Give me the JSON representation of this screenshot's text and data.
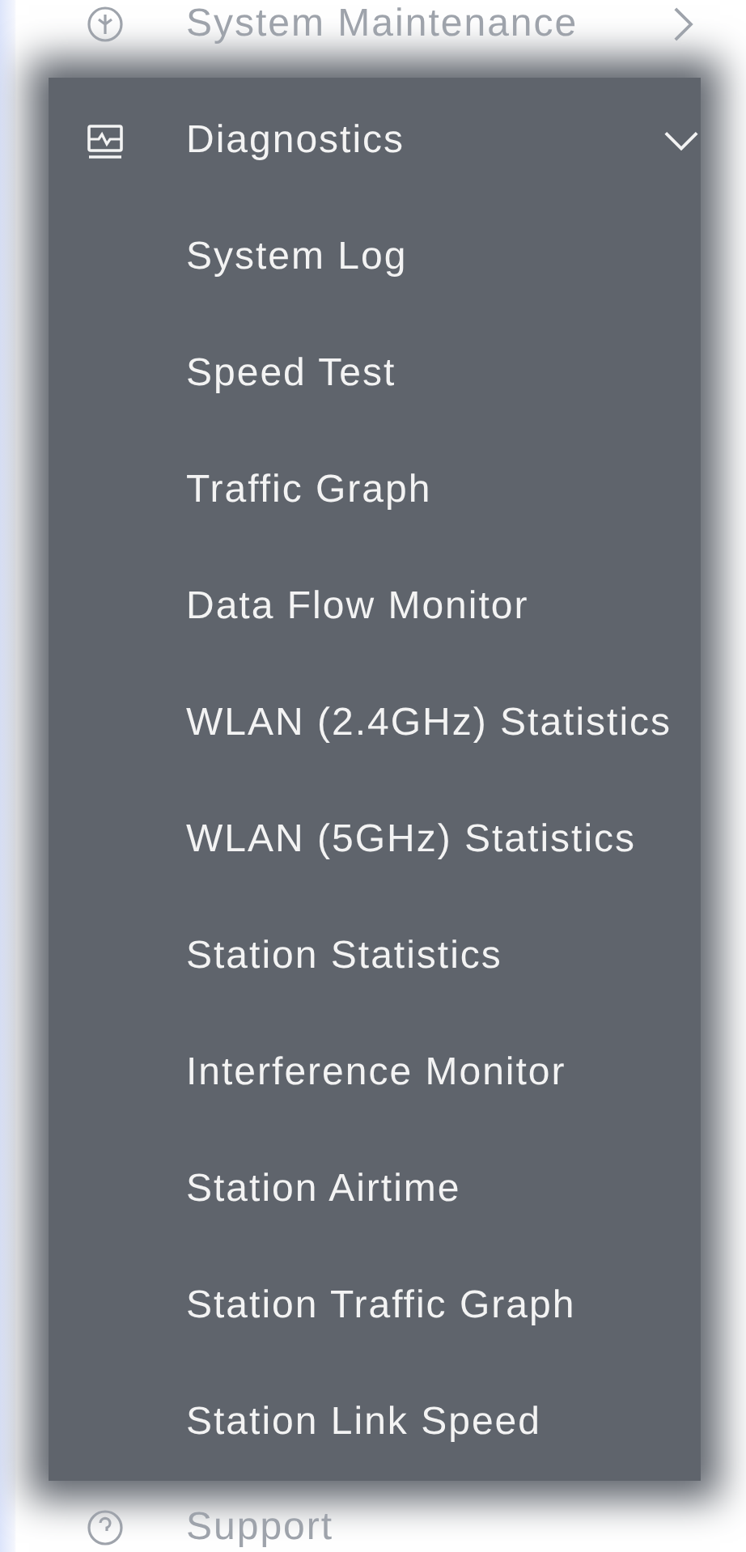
{
  "menu": [
    {
      "label": "System Maintenance",
      "expanded": false
    },
    {
      "label": "Diagnostics",
      "expanded": true,
      "children": [
        {
          "label": "System Log"
        },
        {
          "label": "Speed Test"
        },
        {
          "label": "Traffic Graph"
        },
        {
          "label": "Data Flow Monitor"
        },
        {
          "label": "WLAN (2.4GHz) Statistics"
        },
        {
          "label": "WLAN (5GHz) Statistics"
        },
        {
          "label": "Station Statistics"
        },
        {
          "label": "Interference Monitor"
        },
        {
          "label": "Station Airtime"
        },
        {
          "label": "Station Traffic Graph"
        },
        {
          "label": "Station Link Speed"
        }
      ]
    },
    {
      "label": "Support"
    }
  ]
}
